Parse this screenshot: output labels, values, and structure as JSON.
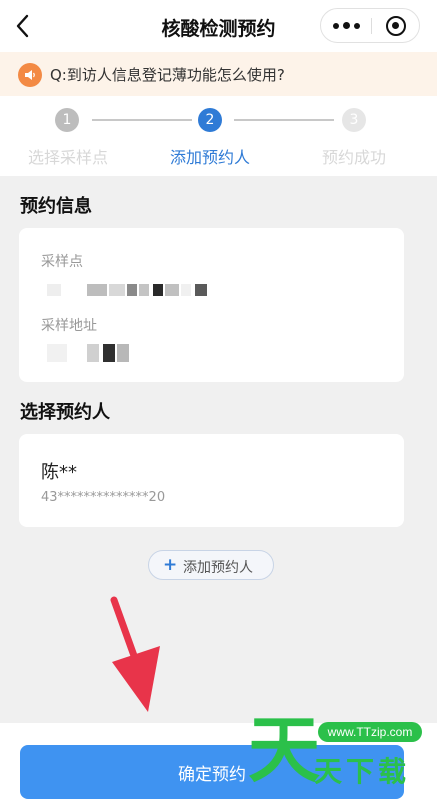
{
  "nav": {
    "title": "核酸检测预约"
  },
  "notice": {
    "text": "Q:到访人信息登记薄功能怎么使用?"
  },
  "steps": [
    {
      "num": "1",
      "label": "选择采样点",
      "state": "done"
    },
    {
      "num": "2",
      "label": "添加预约人",
      "state": "active"
    },
    {
      "num": "3",
      "label": "预约成功",
      "state": "pending"
    }
  ],
  "info": {
    "title": "预约信息",
    "site_label": "采样点",
    "address_label": "采样地址"
  },
  "people": {
    "title": "选择预约人",
    "items": [
      {
        "name": "陈**",
        "id": "43**************20"
      }
    ]
  },
  "add_button": {
    "label": "添加预约人"
  },
  "confirm_button": {
    "label": "确定预约"
  },
  "watermark": {
    "big": "天",
    "site": "www.TTzip.com",
    "rest": "天下载"
  },
  "colors": {
    "accent": "#2f7bd6",
    "button": "#3f93f1",
    "notice_bg": "#fdf3e9",
    "arrow": "#e8344a",
    "watermark": "#2bc04a"
  }
}
